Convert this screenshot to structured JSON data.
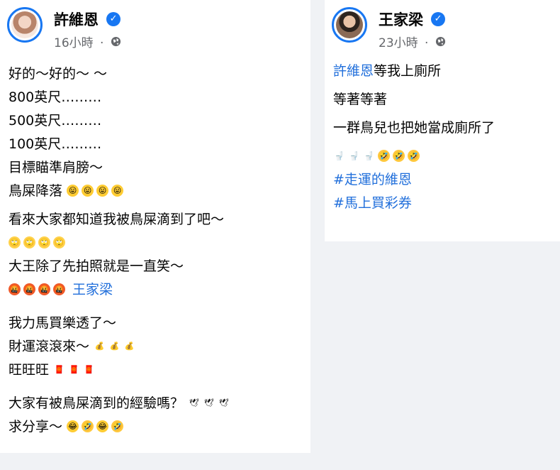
{
  "left_post": {
    "author": "許維恩",
    "time": "16小時",
    "separator": "·",
    "lines": {
      "l1": "好的～好的～ ～",
      "l2": "800英尺………",
      "l3": "500英尺………",
      "l4": "100英尺………",
      "l5": "目標瞄準肩膀～",
      "l6": "鳥屎降落",
      "l7": "看來大家都知道我被鳥屎滴到了吧～",
      "l9": "大王除了先拍照就是一直笑～",
      "l10_mention": "王家梁",
      "l11": "我力馬買樂透了～",
      "l12": "財運滾滾來～",
      "l13": "旺旺旺",
      "l14": "大家有被鳥屎滴到的經驗嗎？",
      "l15": "求分享～"
    }
  },
  "right_post": {
    "author": "王家梁",
    "time": "23小時",
    "separator": "·",
    "mention": "許維恩",
    "line1_rest": "等我上廁所",
    "line2": "等著等著",
    "line3": "一群鳥兒也把她當成廁所了",
    "hashtag1": "#走運的維恩",
    "hashtag2": "#馬上買彩券"
  },
  "icons": {
    "verified": "verified-badge-icon",
    "privacy": "globe-icon"
  },
  "colors": {
    "accent": "#1877f2",
    "link": "#216fdb",
    "meta": "#65676b"
  }
}
